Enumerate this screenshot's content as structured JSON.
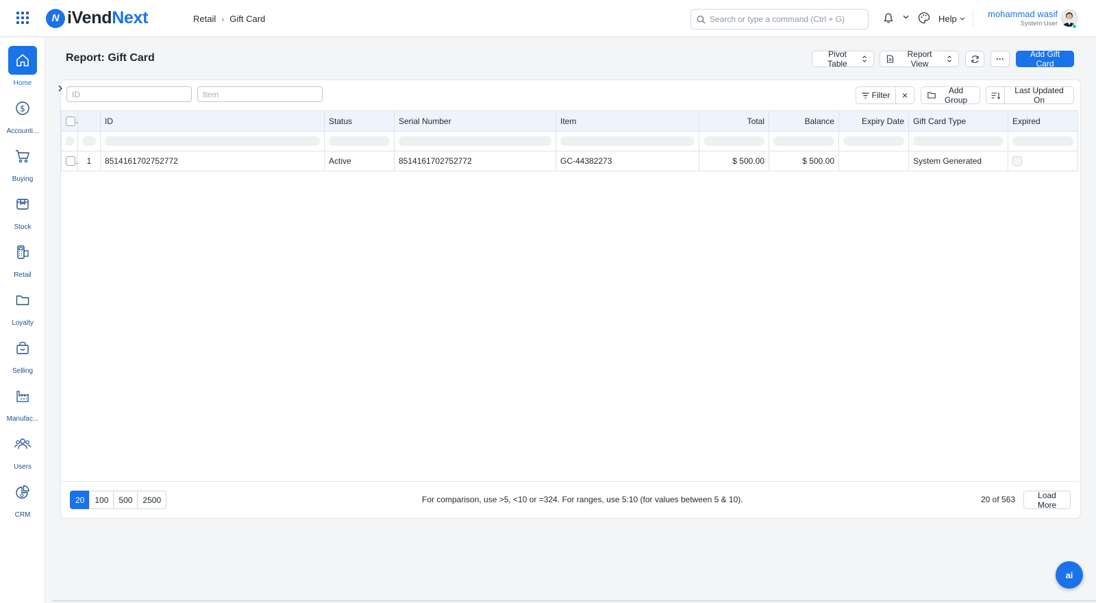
{
  "brand": {
    "name_a": "iVend",
    "name_b": "Next",
    "mark": "N"
  },
  "breadcrumb": [
    "Retail",
    "Gift Card"
  ],
  "search": {
    "placeholder": "Search or type a command (Ctrl + G)"
  },
  "help_label": "Help",
  "user": {
    "name": "mohammad wasif",
    "role": "System User"
  },
  "sidebar": {
    "items": [
      {
        "label": "Home",
        "icon": "home-icon",
        "active": true
      },
      {
        "label": "Accounti...",
        "icon": "dollar-icon"
      },
      {
        "label": "Buying",
        "icon": "cart-icon"
      },
      {
        "label": "Stock",
        "icon": "box-icon"
      },
      {
        "label": "Retail",
        "icon": "pos-terminal-icon"
      },
      {
        "label": "Loyalty",
        "icon": "folder-icon"
      },
      {
        "label": "Selling",
        "icon": "shopping-bag-icon"
      },
      {
        "label": "Manufac...",
        "icon": "factory-icon"
      },
      {
        "label": "Users",
        "icon": "users-icon"
      },
      {
        "label": "CRM",
        "icon": "pie-chart-icon"
      }
    ]
  },
  "page": {
    "title": "Report: Gift Card",
    "pivot_label": "Pivot Table",
    "report_view_label": "Report View",
    "more_label": "···",
    "add_label": "Add Gift Card"
  },
  "filters": {
    "id_placeholder": "ID",
    "item_placeholder": "Item",
    "filter_label": "Filter",
    "clear_label": "×",
    "group_label": "Add Group",
    "sort_label": "Last Updated On"
  },
  "table": {
    "columns": [
      "ID",
      "Status",
      "Serial Number",
      "Item",
      "Total",
      "Balance",
      "Expiry Date",
      "Gift Card Type",
      "Expired"
    ],
    "rows": [
      {
        "index": "1",
        "id": "8514161702752772",
        "status": "Active",
        "serial": "8514161702752772",
        "item": "GC-44382273",
        "total": "$ 500.00",
        "balance": "$ 500.00",
        "expiry": "",
        "type": "System Generated",
        "expired": false
      }
    ]
  },
  "footer": {
    "page_sizes": [
      "20",
      "100",
      "500",
      "2500"
    ],
    "selected_page_size": "20",
    "hint": "For comparison, use >5, <10 or =324. For ranges, use 5:10 (for values between 5 & 10).",
    "count": "20 of 563",
    "load_more": "Load More"
  },
  "ai_button": "ai",
  "colors": {
    "accent": "#1a73e8",
    "header_bg": "#eef4fb"
  }
}
